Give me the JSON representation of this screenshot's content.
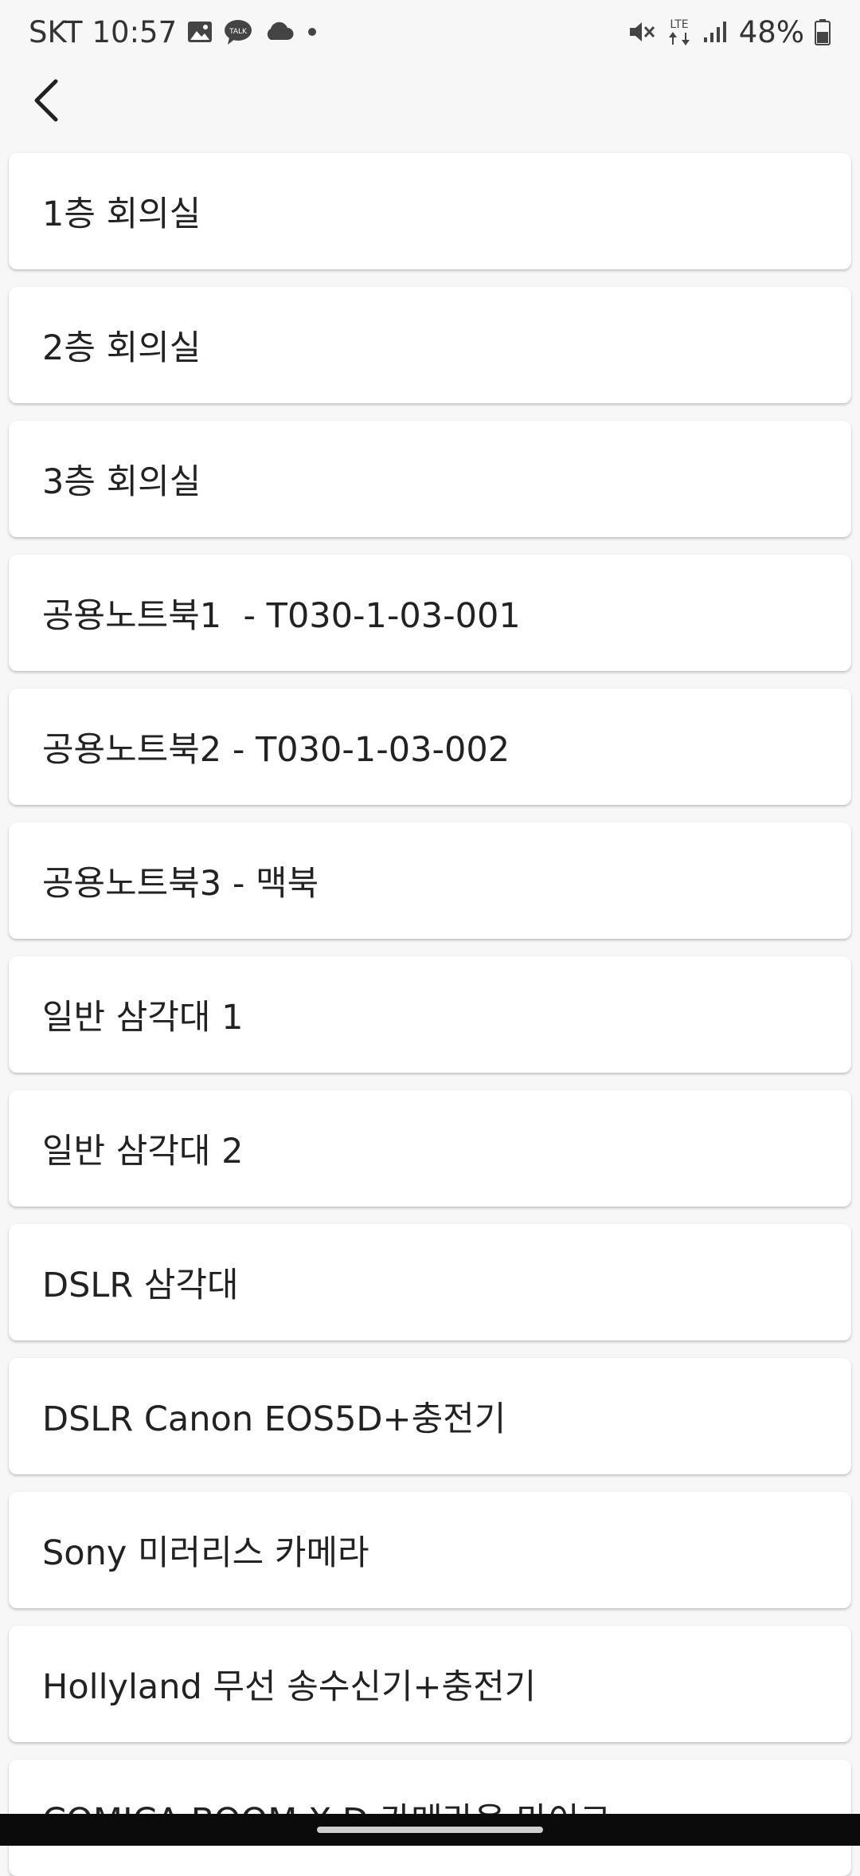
{
  "status_bar": {
    "carrier": "SKT",
    "time": "10:57",
    "network": "LTE",
    "battery_percent": "48%",
    "icons_left": [
      "gallery-icon",
      "talk-icon",
      "cloud-icon",
      "dot-icon"
    ],
    "icons_right": [
      "mute-icon",
      "lte-icon",
      "signal-icon",
      "battery-icon"
    ]
  },
  "header": {
    "back_icon": "chevron-left-icon"
  },
  "items": [
    {
      "label": "1층 회의실"
    },
    {
      "label": "2층 회의실"
    },
    {
      "label": "3층 회의실"
    },
    {
      "label": "공용노트북1  - T030-1-03-001"
    },
    {
      "label": "공용노트북2 - T030-1-03-002"
    },
    {
      "label": "공용노트북3 - 맥북"
    },
    {
      "label": "일반 삼각대 1"
    },
    {
      "label": "일반 삼각대 2"
    },
    {
      "label": "DSLR 삼각대"
    },
    {
      "label": "DSLR Canon EOS5D+충전기"
    },
    {
      "label": "Sony 미러리스 카메라"
    },
    {
      "label": "Hollyland 무선 송수신기+충전기"
    },
    {
      "label": "COMICA BOOM X-D 카메라용 마이크"
    }
  ]
}
